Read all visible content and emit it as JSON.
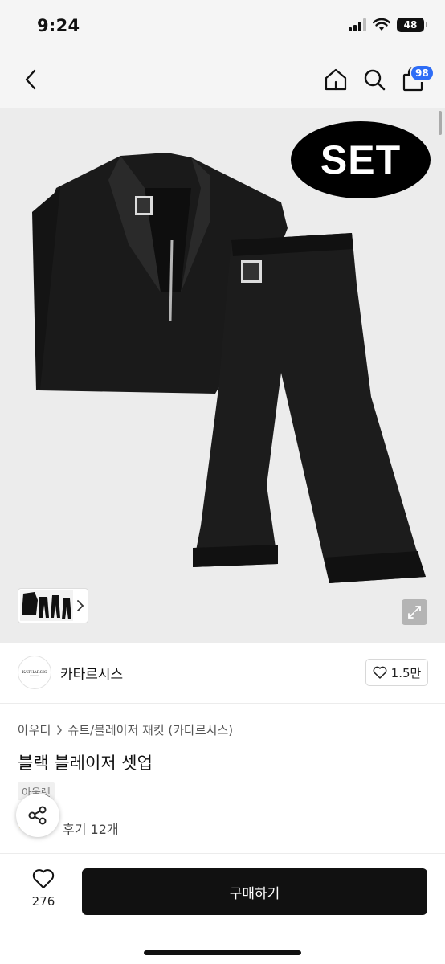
{
  "status_bar": {
    "time": "9:24",
    "battery": "48"
  },
  "nav": {
    "cart_count": "98"
  },
  "product_image": {
    "badge_text": "SET"
  },
  "shop": {
    "name": "카타르시스",
    "logo_text": "KATHARSIS",
    "follow_count": "1.5만"
  },
  "breadcrumb": {
    "category": "아우터",
    "subcategory": "슈트/블레이저 재킷 (카타르시스)"
  },
  "product": {
    "title": "블랙 블레이저 셋업",
    "tag": "아울렛",
    "review_link": "후기 12개"
  },
  "bottom_bar": {
    "like_count": "276",
    "buy_label": "구매하기"
  },
  "colors": {
    "accent": "#2e6df6",
    "buy_button": "#111111",
    "background": "#ffffff"
  }
}
